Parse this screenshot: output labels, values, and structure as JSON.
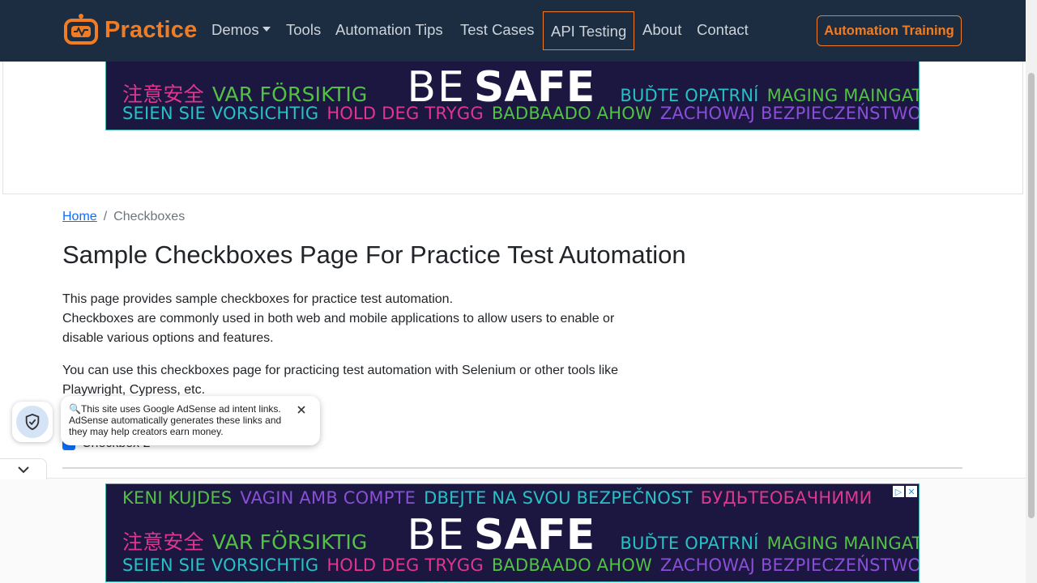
{
  "brand": {
    "name": "Practice",
    "color": "#f07c24"
  },
  "nav": {
    "items": [
      {
        "label": "Demos"
      },
      {
        "label": "Tools"
      },
      {
        "label": "Automation Tips"
      },
      {
        "label": "Test Cases"
      },
      {
        "label": "API Testing"
      },
      {
        "label": "About"
      },
      {
        "label": "Contact"
      }
    ],
    "cta_label": "Automation Training"
  },
  "ad": {
    "row1": [
      "KENI KUJDES",
      "VAGIN AMB COMPTE",
      "DBEJTE NA SVOU BEZPEČNOST",
      "БУДЬТЕОБАЧНИМИ"
    ],
    "row2_left": [
      "注意安全",
      "VAR FÖRSIKTIG"
    ],
    "be": "BE",
    "safe": "SAFE",
    "row2_right": [
      "BUĎTE OPATRNÍ",
      "MAGING MAINGAT"
    ],
    "row3": [
      "SEIEN SIE VORSICHTIG",
      "HOLD DEG TRYGG",
      "BADBAADO AHOW",
      "ZACHOWAJ BEZPIECZEŃSTWO"
    ]
  },
  "breadcrumb": {
    "home": "Home",
    "separator": "/",
    "current": "Checkboxes"
  },
  "page": {
    "title": "Sample Checkboxes Page For Practice Test Automation",
    "p1_line1": "This page provides sample checkboxes for practice test automation.",
    "p1_line2": "Checkboxes are commonly used in both web and mobile applications to allow users to enable or disable various options and features.",
    "p2": "You can use this checkboxes page for practicing test automation with Selenium or other tools like Playwright, Cypress, etc.",
    "checkbox2_label": "Checkbox 2"
  },
  "popup": {
    "text": "🔍This site uses Google AdSense ad intent links. AdSense automatically generates these links and they may help creators earn money."
  }
}
